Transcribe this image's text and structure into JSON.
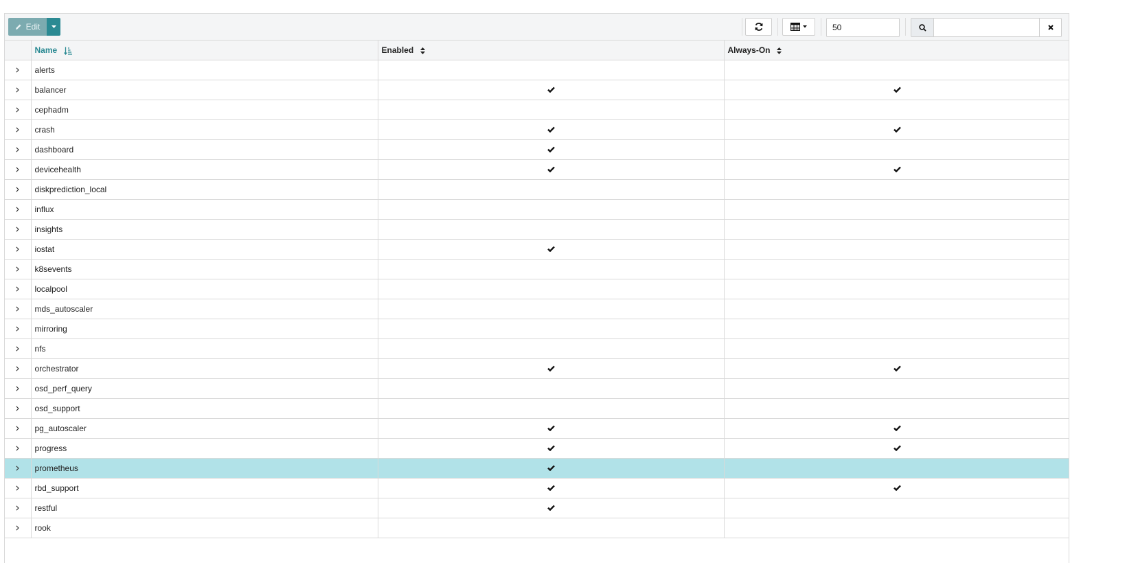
{
  "toolbar": {
    "edit_label": "Edit",
    "limit_value": "50",
    "search_placeholder": "",
    "search_value": ""
  },
  "columns": {
    "name": "Name",
    "enabled": "Enabled",
    "always_on": "Always-On"
  },
  "sort": {
    "column": "name",
    "direction": "ascending"
  },
  "colors": {
    "accent": "#2b8a93",
    "edit_button": "#7cabb0",
    "selected_row": "#b1e2e8"
  },
  "rows": [
    {
      "name": "alerts",
      "enabled": false,
      "always_on": false,
      "selected": false
    },
    {
      "name": "balancer",
      "enabled": true,
      "always_on": true,
      "selected": false
    },
    {
      "name": "cephadm",
      "enabled": false,
      "always_on": false,
      "selected": false
    },
    {
      "name": "crash",
      "enabled": true,
      "always_on": true,
      "selected": false
    },
    {
      "name": "dashboard",
      "enabled": true,
      "always_on": false,
      "selected": false
    },
    {
      "name": "devicehealth",
      "enabled": true,
      "always_on": true,
      "selected": false
    },
    {
      "name": "diskprediction_local",
      "enabled": false,
      "always_on": false,
      "selected": false
    },
    {
      "name": "influx",
      "enabled": false,
      "always_on": false,
      "selected": false
    },
    {
      "name": "insights",
      "enabled": false,
      "always_on": false,
      "selected": false
    },
    {
      "name": "iostat",
      "enabled": true,
      "always_on": false,
      "selected": false
    },
    {
      "name": "k8sevents",
      "enabled": false,
      "always_on": false,
      "selected": false
    },
    {
      "name": "localpool",
      "enabled": false,
      "always_on": false,
      "selected": false
    },
    {
      "name": "mds_autoscaler",
      "enabled": false,
      "always_on": false,
      "selected": false
    },
    {
      "name": "mirroring",
      "enabled": false,
      "always_on": false,
      "selected": false
    },
    {
      "name": "nfs",
      "enabled": false,
      "always_on": false,
      "selected": false
    },
    {
      "name": "orchestrator",
      "enabled": true,
      "always_on": true,
      "selected": false
    },
    {
      "name": "osd_perf_query",
      "enabled": false,
      "always_on": false,
      "selected": false
    },
    {
      "name": "osd_support",
      "enabled": false,
      "always_on": false,
      "selected": false
    },
    {
      "name": "pg_autoscaler",
      "enabled": true,
      "always_on": true,
      "selected": false
    },
    {
      "name": "progress",
      "enabled": true,
      "always_on": true,
      "selected": false
    },
    {
      "name": "prometheus",
      "enabled": true,
      "always_on": false,
      "selected": true
    },
    {
      "name": "rbd_support",
      "enabled": true,
      "always_on": true,
      "selected": false
    },
    {
      "name": "restful",
      "enabled": true,
      "always_on": false,
      "selected": false
    },
    {
      "name": "rook",
      "enabled": false,
      "always_on": false,
      "selected": false
    }
  ]
}
